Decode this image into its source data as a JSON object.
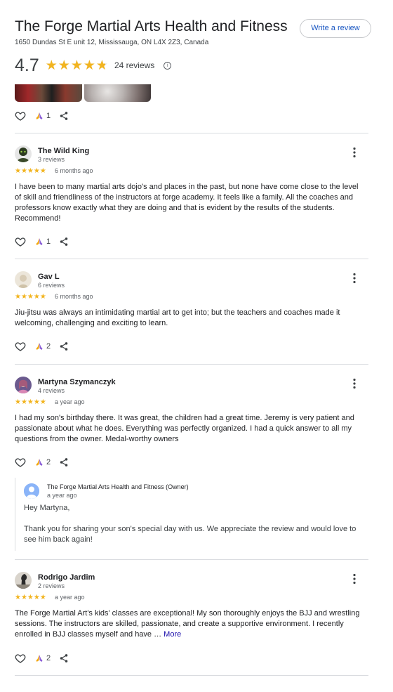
{
  "business": {
    "name": "The Forge Martial Arts Health and Fitness",
    "address": "1650 Dundas St E unit 12, Mississauga, ON L4X 2Z3, Canada",
    "write_review_label": "Write a review",
    "rating": "4.7",
    "rating_value": 4.7,
    "review_count_label": "24 reviews",
    "stars_glyph": "★★★★★"
  },
  "top_actions": {
    "helpful_count": "1"
  },
  "reviews": [
    {
      "name": "The Wild King",
      "meta": "3 reviews",
      "stars": "★★★★★",
      "date": "6 months ago",
      "text": "I have been to many martial arts dojo's and places in the past, but none have come close to the level of skill and friendliness of the instructors at forge academy. It feels like a family. All the coaches and professors know exactly what they are doing and that is evident by the results of the students. Recommend!",
      "helpful_count": "1"
    },
    {
      "name": "Gav L",
      "meta": "6 reviews",
      "stars": "★★★★★",
      "date": "6 months ago",
      "text": "Jiu-jitsu was always an intimidating martial art to get into; but the teachers and coaches made it welcoming, challenging and exciting to learn.",
      "helpful_count": "2"
    },
    {
      "name": "Martyna Szymanczyk",
      "meta": "4 reviews",
      "stars": "★★★★★",
      "date": "a year ago",
      "text": "I had my son's birthday there. It was great, the children had a great time. Jeremy is very patient and passionate about what he does. Everything was perfectly organized. I had a quick answer to all my questions from the owner. Medal-worthy owners",
      "helpful_count": "2",
      "owner_reply": {
        "name": "The Forge Martial Arts Health and Fitness (Owner)",
        "date": "a year ago",
        "text": "Hey Martyna,\n\nThank you for sharing your son's special day with us. We appreciate the review and would love to see him back again!"
      }
    },
    {
      "name": "Rodrigo Jardim",
      "meta": "2 reviews",
      "stars": "★★★★★",
      "date": "a year ago",
      "text": "The Forge Martial Art's kids' classes are exceptional! My son thoroughly enjoys the BJJ and wrestling sessions. The instructors are skilled, passionate, and create a supportive environment. I recently enrolled in BJJ classes myself and have …",
      "more_label": "More",
      "helpful_count": "2"
    }
  ],
  "icons": {
    "like": "heart-outline-icon",
    "helpful": "helpful-hands-icon",
    "share": "share-icon",
    "more": "more-vertical-icon",
    "info": "info-icon"
  },
  "colors": {
    "star": "#f2b41f",
    "link": "#1a0dab",
    "button_text": "#1a57c2",
    "divider": "#dadce0"
  }
}
